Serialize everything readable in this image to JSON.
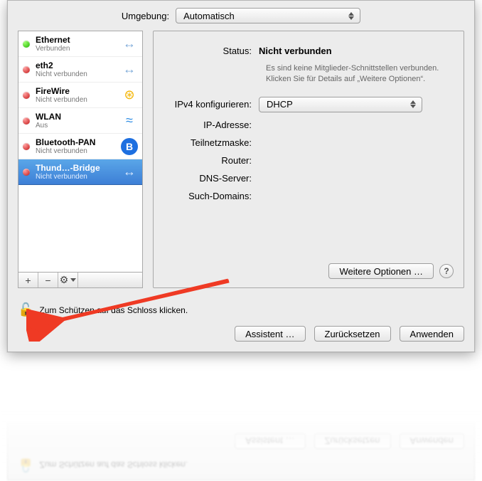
{
  "topbar": {
    "location_label": "Umgebung:",
    "location_value": "Automatisch"
  },
  "sidebar": {
    "items": [
      {
        "name": "Ethernet",
        "status": "Verbunden",
        "dot": "green",
        "icon": "↔"
      },
      {
        "name": "eth2",
        "status": "Nicht verbunden",
        "dot": "red",
        "icon": "↔"
      },
      {
        "name": "FireWire",
        "status": "Nicht verbunden",
        "dot": "red",
        "icon": "⊛"
      },
      {
        "name": "WLAN",
        "status": "Aus",
        "dot": "red",
        "icon": "≈"
      },
      {
        "name": "Bluetooth-PAN",
        "status": "Nicht verbunden",
        "dot": "red",
        "icon": "B"
      },
      {
        "name": "Thund…-Bridge",
        "status": "Nicht verbunden",
        "dot": "red",
        "icon": "↔"
      }
    ],
    "selected_index": 5,
    "toolbar": {
      "add": "+",
      "remove": "−",
      "gear": "⚙"
    }
  },
  "detail": {
    "status_label": "Status:",
    "status_value": "Nicht verbunden",
    "hint": "Es sind keine Mitglieder-Schnittstellen verbunden. Klicken Sie für Details auf „Weitere Optionen“.",
    "ipv4_label": "IPv4 konfigurieren:",
    "ipv4_value": "DHCP",
    "ip_label": "IP-Adresse:",
    "subnet_label": "Teilnetzmaske:",
    "router_label": "Router:",
    "dns_label": "DNS-Server:",
    "search_label": "Such-Domains:",
    "more_options": "Weitere Optionen …"
  },
  "lockrow": {
    "text": "Zum Schützen auf das Schloss klicken."
  },
  "actions": {
    "assistant": "Assistent …",
    "reset": "Zurücksetzen",
    "apply": "Anwenden"
  }
}
